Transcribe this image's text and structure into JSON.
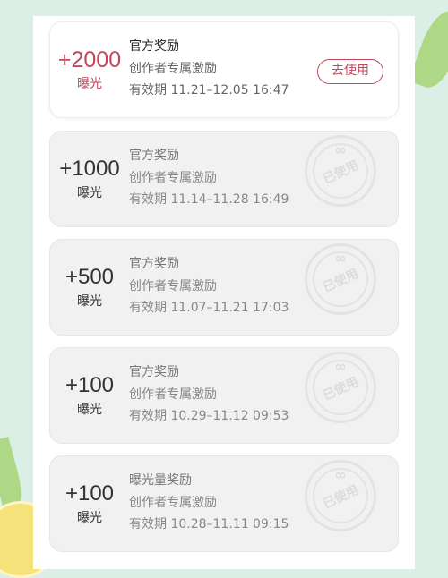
{
  "cards": [
    {
      "amount": "+2000",
      "unit": "曝光",
      "title": "官方奖励",
      "subtitle": "创作者专属激励",
      "validity": "有效期 11.21–12.05 16:47",
      "button": "去使用"
    },
    {
      "amount": "+1000",
      "unit": "曝光",
      "title": "官方奖励",
      "subtitle": "创作者专属激励",
      "validity": "有效期 11.14–11.28 16:49",
      "stamp": "已使用"
    },
    {
      "amount": "+500",
      "unit": "曝光",
      "title": "官方奖励",
      "subtitle": "创作者专属激励",
      "validity": "有效期 11.07–11.21 17:03",
      "stamp": "已使用"
    },
    {
      "amount": "+100",
      "unit": "曝光",
      "title": "官方奖励",
      "subtitle": "创作者专属激励",
      "validity": "有效期 10.29–11.12 09:53",
      "stamp": "已使用"
    },
    {
      "amount": "+100",
      "unit": "曝光",
      "title": "曝光量奖励",
      "subtitle": "创作者专属激励",
      "validity": "有效期 10.28–11.11 09:15",
      "stamp": "已使用"
    }
  ],
  "colors": {
    "accent": "#c2475c",
    "background": "#dcefe6"
  },
  "icons": {
    "stamp_symbol": "∞"
  }
}
